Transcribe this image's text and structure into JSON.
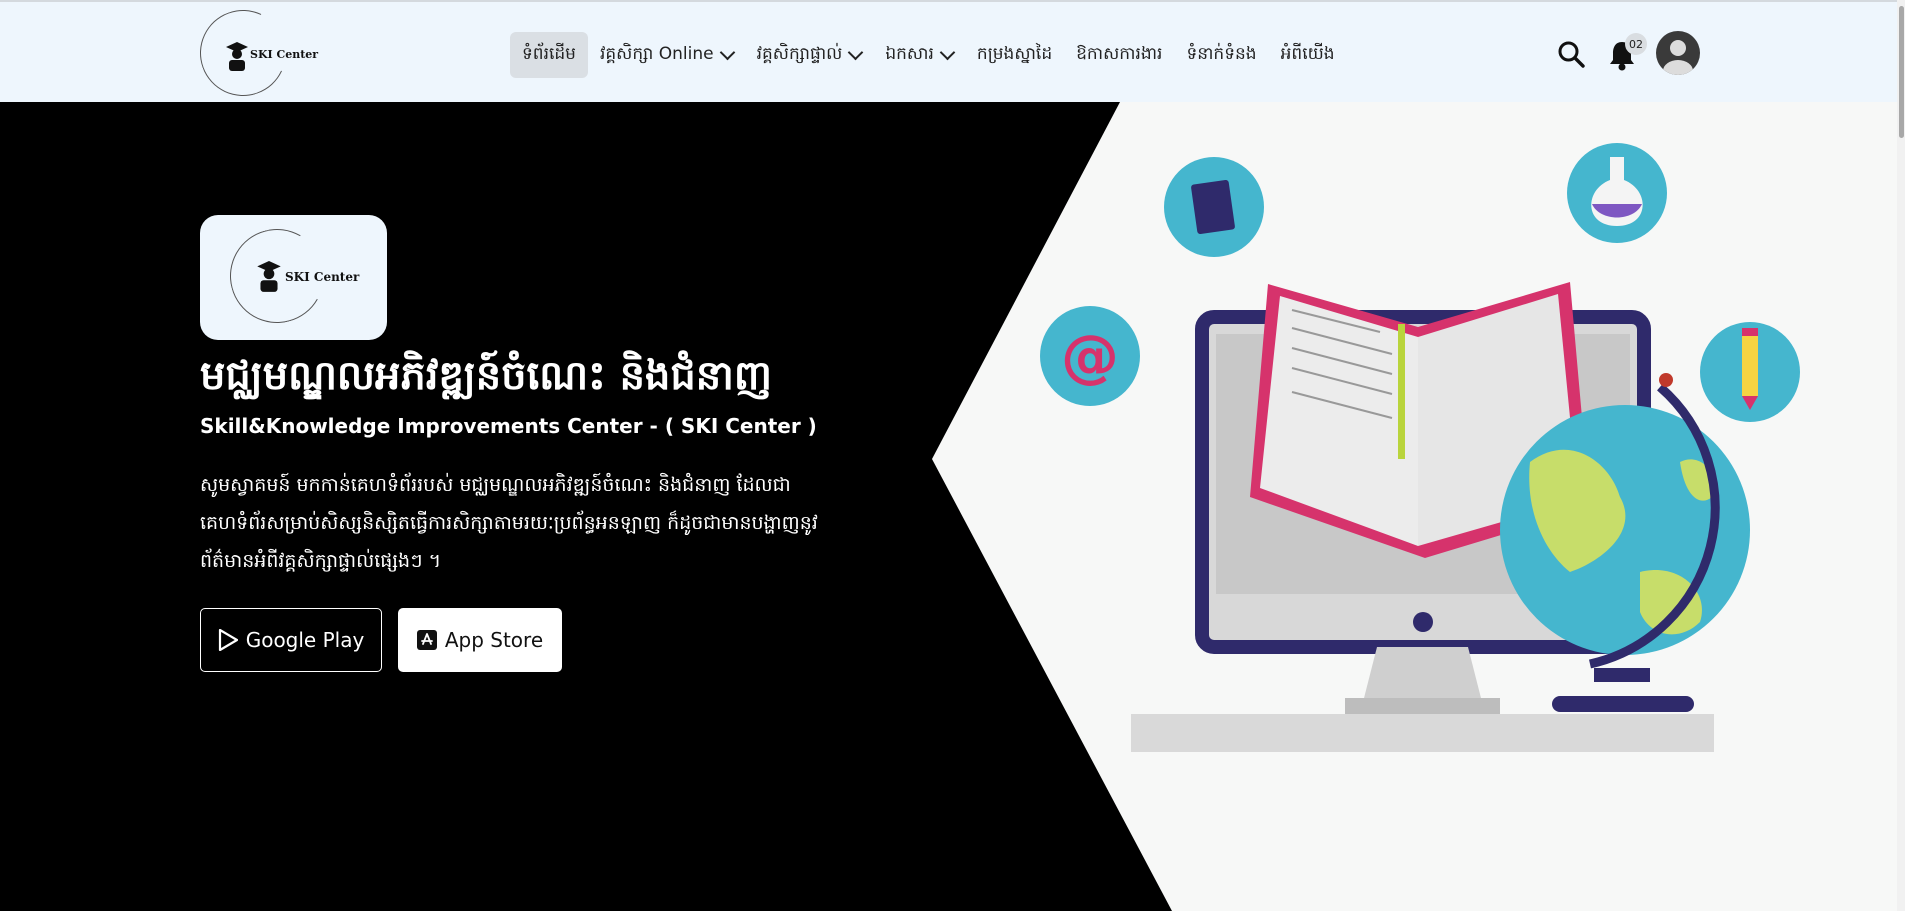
{
  "header": {
    "logo_text": "SKI Center",
    "nav": [
      {
        "label": "ទំព័រដើម",
        "active": true
      },
      {
        "label": "វគ្គសិក្សា Online",
        "dropdown": true
      },
      {
        "label": "វគ្គសិក្សាផ្ទាល់",
        "dropdown": true
      },
      {
        "label": "ឯកសារ",
        "dropdown": true
      },
      {
        "label": "កម្រងស្នាដៃ"
      },
      {
        "label": "ឱកាសការងារ"
      },
      {
        "label": "ទំនាក់ទំនង"
      },
      {
        "label": "អំពីយើង"
      }
    ],
    "notification_count": "02"
  },
  "hero": {
    "logo_text": "SKI Center",
    "title": "មជ្ឈមណ្ឌលអភិវឌ្ឍន៍ចំណេះ និងជំនាញ",
    "subtitle": "Skill&Knowledge Improvements Center - ( SKI Center )",
    "description": "សូមស្វាគមន៍ មកកាន់គេហទំព័ររបស់ មជ្ឈមណ្ឌលអភិវឌ្ឍន៍ចំណេះ និងជំនាញ ដែលជាគេហទំព័រសម្រាប់សិស្សនិស្សិតធ្វើការសិក្សាតាមរយៈប្រព័ន្ធអនឡាញ ក៏ដូចជាមានបង្ហាញនូវព័ត៌មានអំពីវគ្គសិក្សាផ្ទាល់ផ្សេងៗ ។",
    "google_play_label": "Google Play",
    "app_store_label": "App Store"
  },
  "colors": {
    "header_bg": "#eef6fd",
    "hero_bg": "#000000",
    "accent_pink": "#d6336c",
    "accent_teal": "#45b6ce"
  }
}
